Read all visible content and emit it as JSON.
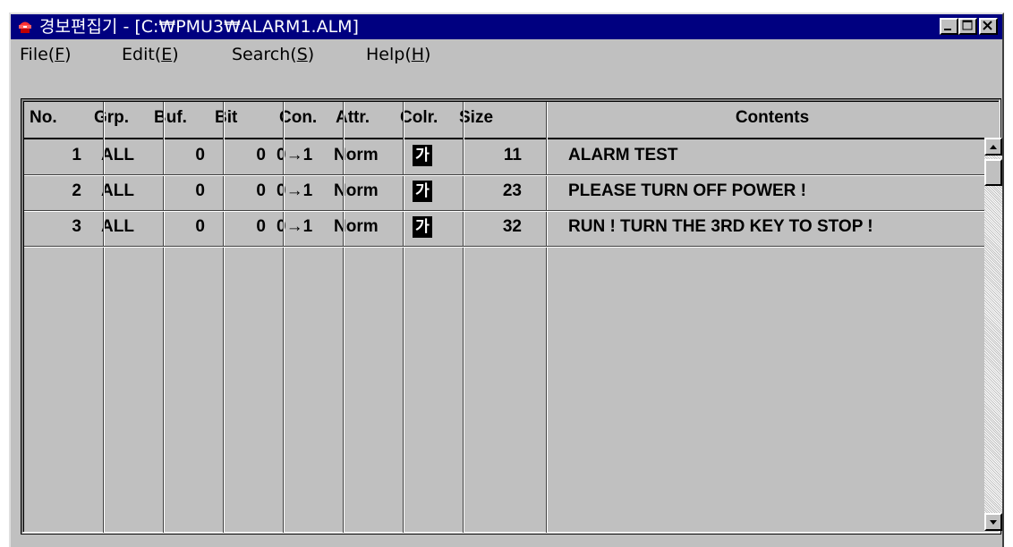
{
  "window": {
    "title": "경보편집기 - [C:₩PMU3₩ALARM1.ALM]",
    "icon": "alarm-bell-icon",
    "controls": [
      "minimize-icon",
      "maximize-icon",
      "close-icon"
    ]
  },
  "menu": [
    {
      "label": "File(",
      "key": "F",
      "suffix": ")"
    },
    {
      "label": "Edit(",
      "key": "E",
      "suffix": ")"
    },
    {
      "label": "Search(",
      "key": "S",
      "suffix": ")"
    },
    {
      "label": "Help(",
      "key": "H",
      "suffix": ")"
    }
  ],
  "table": {
    "headers": [
      "No.",
      "Grp.",
      "Buf.",
      "Bit",
      "Con.",
      "Attr.",
      "Colr.",
      "Size",
      "Contents"
    ],
    "rows": [
      {
        "no": "1",
        "grp": "ALL",
        "buf": "0",
        "bit": "0",
        "con": "0→1",
        "attr": "Norm",
        "colr": "가",
        "size": "11",
        "contents": "ALARM TEST"
      },
      {
        "no": "2",
        "grp": "ALL",
        "buf": "0",
        "bit": "0",
        "con": "0→1",
        "attr": "Norm",
        "colr": "가",
        "size": "23",
        "contents": "PLEASE TURN OFF POWER !"
      },
      {
        "no": "3",
        "grp": "ALL",
        "buf": "0",
        "bit": "0",
        "con": "0→1",
        "attr": "Norm",
        "colr": "가",
        "size": "32",
        "contents": "RUN ! TURN THE 3RD KEY TO STOP !"
      }
    ]
  },
  "colors": {
    "titlebar": "#000080",
    "face": "#c0c0c0",
    "swatch": "#000000"
  }
}
